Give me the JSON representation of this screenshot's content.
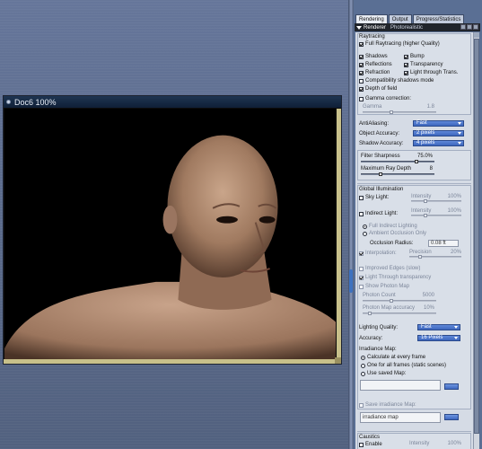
{
  "document": {
    "title": "Doc6 100%"
  },
  "panel": {
    "tabs": [
      "Rendering",
      "Output",
      "Progress/Statistics"
    ],
    "header_label": "Renderer",
    "header_value": "Photorealistic"
  },
  "raytracing": {
    "title": "Raytracing",
    "full": "Full Raytracing (higher Quality)",
    "shadows": "Shadows",
    "bump": "Bump",
    "reflections": "Reflections",
    "transparency": "Transparency",
    "refraction": "Refraction",
    "light_through_trans": "Light through Trans.",
    "compat_shadows": "Compatibility shadows mode",
    "depth_of_field": "Depth of field",
    "gamma_correction": "Gamma correction:",
    "gamma_label": "Gamma",
    "gamma_value": "1.8"
  },
  "settings": {
    "antialiasing_label": "AntiAliasing:",
    "antialiasing_value": "Fast",
    "object_accuracy_label": "Object Accuracy:",
    "object_accuracy_value": "2 pixels",
    "shadow_accuracy_label": "Shadow Accuracy:",
    "shadow_accuracy_value": "4 pixels",
    "filter_sharpness_label": "Filter Sharpness",
    "filter_sharpness_value": "75.0%",
    "max_ray_depth_label": "Maximum Ray Depth",
    "max_ray_depth_value": "8"
  },
  "gi": {
    "title": "Global Illumination",
    "sky_light": "Sky Light:",
    "sky_intensity_label": "Intensity",
    "sky_intensity_value": "100%",
    "indirect_light": "Indirect Light:",
    "indirect_intensity_label": "Intensity",
    "indirect_intensity_value": "100%",
    "full_indirect": "Full Indirect Lighting",
    "ambient_occlusion": "Ambient Occlusion Only",
    "occlusion_radius_label": "Occlusion Radius:",
    "occlusion_radius_value": "0.08 ft",
    "interpolation": "Interpolation:",
    "precision_label": "Precision",
    "precision_value": "20%",
    "improved_edges": "Improved Edges (slow)",
    "light_through_transparency": "Light Through transparency",
    "show_photon_map": "Show Photon Map",
    "photon_count_label": "Photon Count",
    "photon_count_value": "5000",
    "photon_accuracy_label": "Photon Map accuracy",
    "photon_accuracy_value": "10%",
    "lighting_quality_label": "Lighting Quality:",
    "lighting_quality_value": "Fast",
    "accuracy_label": "Accuracy:",
    "accuracy_value": "16 Pixels",
    "irradiance_map_label": "Irradiance Map:",
    "calc_every_frame": "Calculate at every frame",
    "one_for_all": "One for all frames (static scenes)",
    "use_saved_map": "Use saved Map:",
    "saved_map_path": "",
    "save_irradiance_map": "Save irradiance Map:",
    "irradiance_map_name": "irradiance map"
  },
  "caustics": {
    "title": "Caustics",
    "enable": "Enable",
    "intensity_label": "Intensity",
    "intensity_value": "100%"
  }
}
